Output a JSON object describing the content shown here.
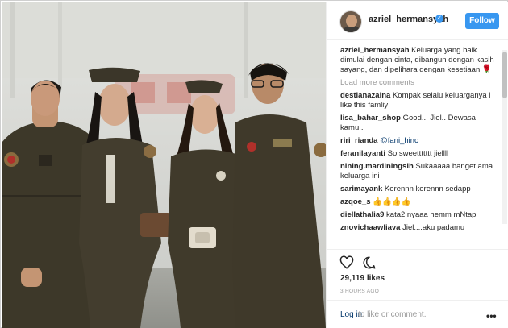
{
  "post": {
    "username": "azriel_hermansyah",
    "follow_label": "Follow",
    "caption_user": "azriel_hermansyah",
    "caption_text": " Keluarga yang baik dimulai dengan cinta, dibangun dengan kasih sayang, dan dipelihara dengan kesetiaan ",
    "caption_emoji": "🌹",
    "load_more": "Load more comments",
    "likes": "29,119 likes",
    "timestamp": "3 HOURS AGO",
    "login_link": "Log in",
    "login_rest": " to like or comment.",
    "more_label": "•••"
  },
  "comments": [
    {
      "user": "destianazaina",
      "text": " Kompak selalu keluarganya i like this famliy"
    },
    {
      "user": "lisa_bahar_shop",
      "text": " Good... Jiel.. Dewasa kamu.."
    },
    {
      "user": "riri_rianda",
      "text": "",
      "mention": " @fani_hino"
    },
    {
      "user": "feranilayanti",
      "text": " So sweettttttt jiellll"
    },
    {
      "user": "nining.mardiningsih",
      "text": " Sukaaaaa banget ama keluarga ini"
    },
    {
      "user": "sarimayank",
      "text": " Kerennn kerennn sedapp"
    },
    {
      "user": "azqoe_s",
      "text": " 👍👍👍👍"
    },
    {
      "user": "diellathalia9",
      "text": " kata2 nyaaa hemm mNtap"
    },
    {
      "user": "znovichaawliava",
      "text": " Jiel....aku padamu"
    }
  ],
  "colors": {
    "accent": "#3897f0",
    "uniform": "#3f3a2c",
    "background": "#d8d9d6"
  },
  "icons": {
    "like": "heart-icon",
    "comment": "comment-icon",
    "verified": "verified-badge-icon",
    "more": "more-options-icon"
  }
}
